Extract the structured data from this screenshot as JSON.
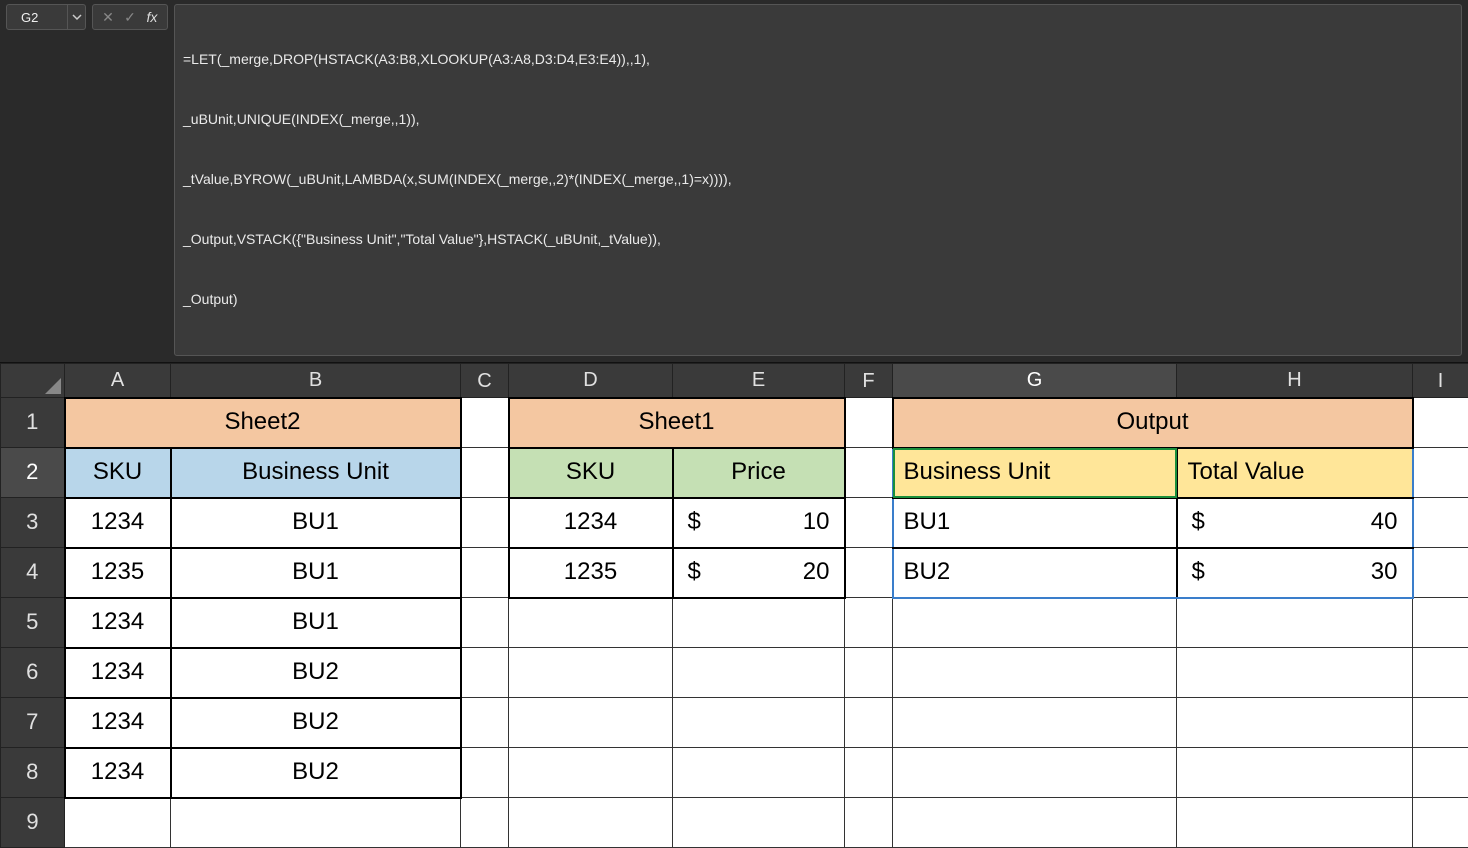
{
  "name_box": {
    "value": "G2"
  },
  "formula_bar": {
    "lines": [
      "=LET(_merge,DROP(HSTACK(A3:B8,XLOOKUP(A3:A8,D3:D4,E3:E4)),,1),",
      "_uBUnit,UNIQUE(INDEX(_merge,,1)),",
      "_tValue,BYROW(_uBUnit,LAMBDA(x,SUM(INDEX(_merge,,2)*(INDEX(_merge,,1)=x)))),",
      "_Output,VSTACK({\"Business Unit\",\"Total Value\"},HSTACK(_uBUnit,_tValue)),",
      "_Output)"
    ]
  },
  "columns": [
    "A",
    "B",
    "C",
    "D",
    "E",
    "F",
    "G",
    "H",
    "I"
  ],
  "rows": [
    "1",
    "2",
    "3",
    "4",
    "5",
    "6",
    "7",
    "8",
    "9"
  ],
  "titles": {
    "sheet2": "Sheet2",
    "sheet1": "Sheet1",
    "output": "Output"
  },
  "sheet2": {
    "headers": {
      "sku": "SKU",
      "bu": "Business Unit"
    },
    "rows": [
      {
        "sku": "1234",
        "bu": "BU1"
      },
      {
        "sku": "1235",
        "bu": "BU1"
      },
      {
        "sku": "1234",
        "bu": "BU1"
      },
      {
        "sku": "1234",
        "bu": "BU2"
      },
      {
        "sku": "1234",
        "bu": "BU2"
      },
      {
        "sku": "1234",
        "bu": "BU2"
      }
    ]
  },
  "sheet1": {
    "headers": {
      "sku": "SKU",
      "price": "Price"
    },
    "rows": [
      {
        "sku": "1234",
        "currency": "$",
        "price": "10"
      },
      {
        "sku": "1235",
        "currency": "$",
        "price": "20"
      }
    ]
  },
  "output": {
    "headers": {
      "bu": "Business Unit",
      "total": "Total Value"
    },
    "rows": [
      {
        "bu": "BU1",
        "currency": "$",
        "total": "40"
      },
      {
        "bu": "BU2",
        "currency": "$",
        "total": "30"
      }
    ]
  },
  "chart_data": {
    "type": "table",
    "title": "Output",
    "columns": [
      "Business Unit",
      "Total Value"
    ],
    "rows": [
      [
        "BU1",
        40
      ],
      [
        "BU2",
        30
      ]
    ]
  }
}
